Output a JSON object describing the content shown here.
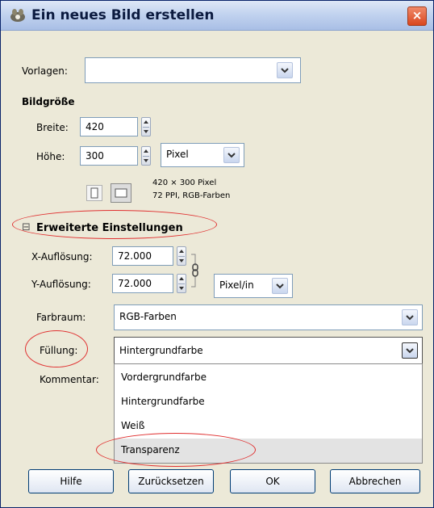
{
  "window": {
    "title": "Ein neues Bild erstellen",
    "close_label": "×"
  },
  "template": {
    "label": "Vorlagen:",
    "value": ""
  },
  "image_size": {
    "heading": "Bildgröße",
    "width_label": "Breite:",
    "width_value": "420",
    "height_label": "Höhe:",
    "height_value": "300",
    "unit": "Pixel",
    "info_line1": "420 × 300 Pixel",
    "info_line2": "72 PPI, RGB-Farben"
  },
  "advanced": {
    "toggle": "⊟",
    "heading": "Erweiterte Einstellungen",
    "x_res_label": "X-Auflösung:",
    "x_res_value": "72.000",
    "y_res_label": "Y-Auflösung:",
    "y_res_value": "72.000",
    "res_unit": "Pixel/in",
    "colorspace_label": "Farbraum:",
    "colorspace_value": "RGB-Farben",
    "fill_label": "Füllung:",
    "fill_value": "Hintergrundfarbe",
    "comment_label": "Kommentar:"
  },
  "fill_options": [
    "Vordergrundfarbe",
    "Hintergrundfarbe",
    "Weiß",
    "Transparenz"
  ],
  "buttons": {
    "help": "Hilfe",
    "reset": "Zurücksetzen",
    "ok": "OK",
    "cancel": "Abbrechen"
  },
  "colors": {
    "highlight_oval": "#e03030",
    "title_text": "#0b1a3f"
  },
  "icons": [
    "gimp-icon",
    "close-icon",
    "portrait-icon",
    "landscape-icon",
    "chain-icon",
    "chevron-down-icon",
    "collapse-icon"
  ]
}
